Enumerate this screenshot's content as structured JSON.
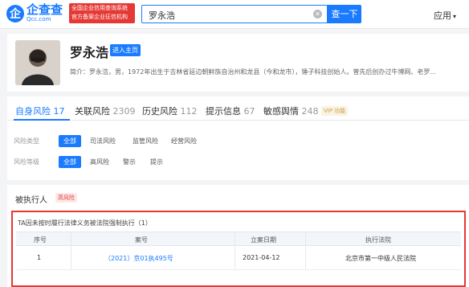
{
  "header": {
    "logo_mark": "企",
    "logo_cn": "企查查",
    "logo_en": "Qcc.com",
    "badge_line1": "全国企业信用查询系统",
    "badge_line2": "官方备案企业征信机构",
    "search_value": "罗永浩",
    "search_button": "查一下",
    "app_menu": "应用"
  },
  "profile": {
    "name": "罗永浩",
    "home_button": "进入主页",
    "bio": "简介：罗永浩，男，1972年出生于吉林省延边朝鲜族自治州和龙县（今和龙市），锤子科技创始人。曾先后创办过牛博网、老罗..."
  },
  "tabs": [
    {
      "label": "自身风险",
      "count": "17"
    },
    {
      "label": "关联风险",
      "count": "2309"
    },
    {
      "label": "历史风险",
      "count": "112"
    },
    {
      "label": "提示信息",
      "count": "67"
    },
    {
      "label": "敏感舆情",
      "count": "248"
    }
  ],
  "vip_label": "VIP 功能",
  "filters": {
    "type_label": "风险类型",
    "type_options": [
      "全部",
      "司法风险",
      "监管风险",
      "经营风险"
    ],
    "level_label": "风险等级",
    "level_options": [
      "全部",
      "高风险",
      "警示",
      "提示"
    ]
  },
  "section": {
    "title": "被执行人",
    "tag": "高风险",
    "box_title": "TA因未按时履行法律义务被法院强制执行（1）"
  },
  "table": {
    "headers": [
      "序号",
      "案号",
      "立案日期",
      "执行法院"
    ],
    "rows": [
      {
        "index": "1",
        "case_no": "（2021）京01执495号",
        "date": "2021-04-12",
        "court": "北京市第一中级人民法院"
      }
    ]
  },
  "colors": {
    "accent": "#1a7bff",
    "alert": "#e53935"
  }
}
